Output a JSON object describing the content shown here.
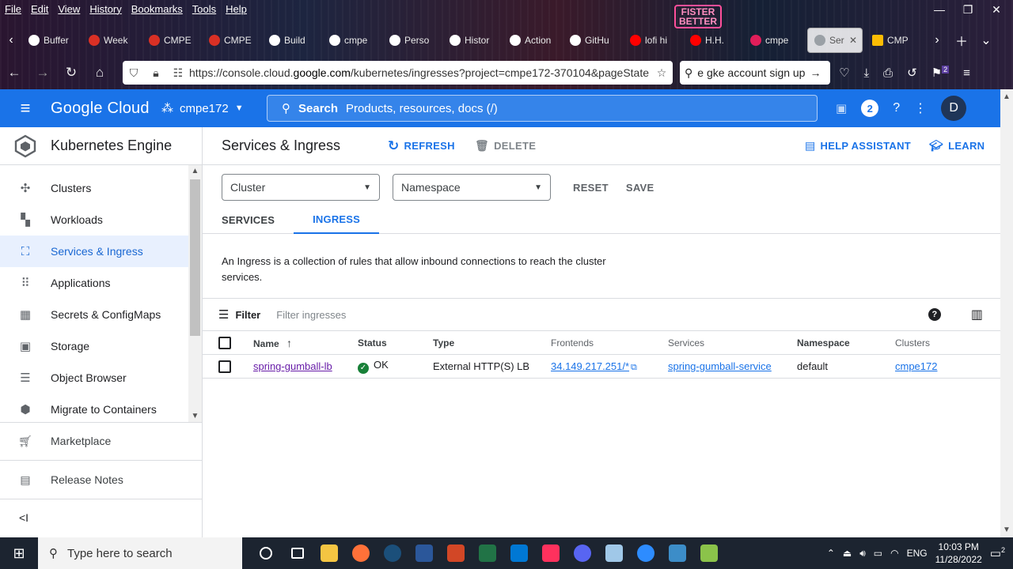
{
  "browser": {
    "menu": [
      "File",
      "Edit",
      "View",
      "History",
      "Bookmarks",
      "Tools",
      "Help"
    ],
    "neon_sign": [
      "FISTER",
      "BETTER"
    ],
    "tabs": [
      {
        "label": "Buffer",
        "color": "#ffffff"
      },
      {
        "label": "Week",
        "color": "#d93025"
      },
      {
        "label": "CMPE",
        "color": "#d93025"
      },
      {
        "label": "CMPE",
        "color": "#d93025"
      },
      {
        "label": "Build",
        "color": "#ffffff"
      },
      {
        "label": "cmpe",
        "color": "#ffffff"
      },
      {
        "label": "Perso",
        "color": "#ffffff"
      },
      {
        "label": "Histor",
        "color": "#ffffff"
      },
      {
        "label": "Action",
        "color": "#ffffff"
      },
      {
        "label": "GitHu",
        "color": "#ffffff"
      },
      {
        "label": "lofi hi",
        "color": "#ff0000"
      },
      {
        "label": "H.H.",
        "color": "#ff0000"
      },
      {
        "label": "cmpe",
        "color": "#e01e5a"
      }
    ],
    "active_tab": "Ser",
    "after_tab": "CMP",
    "url_prefix": "https://console.cloud.",
    "url_domain": "google.com",
    "url_rest": "/kubernetes/ingresses?project=cmpe172-370104&pageState",
    "search_value": "e gke account sign up",
    "notif_count": "2"
  },
  "header": {
    "brand": "Google Cloud",
    "project": "cmpe172",
    "search_label": "Search",
    "search_placeholder": "Products, resources, docs (/)",
    "notification_count": "2",
    "avatar_letter": "D"
  },
  "sidebar": {
    "product_title": "Kubernetes Engine",
    "items": [
      {
        "label": "Clusters",
        "icon": "✣"
      },
      {
        "label": "Workloads",
        "icon": "▚"
      },
      {
        "label": "Services & Ingress",
        "icon": "⛶"
      },
      {
        "label": "Applications",
        "icon": "⠿"
      },
      {
        "label": "Secrets & ConfigMaps",
        "icon": "▦"
      },
      {
        "label": "Storage",
        "icon": "▣"
      },
      {
        "label": "Object Browser",
        "icon": "☰"
      },
      {
        "label": "Migrate to Containers",
        "icon": "⬢"
      }
    ],
    "marketplace": "Marketplace",
    "release_notes": "Release Notes",
    "collapse": "<I"
  },
  "page": {
    "title": "Services & Ingress",
    "refresh": "REFRESH",
    "delete": "DELETE",
    "help_assistant": "HELP ASSISTANT",
    "learn": "LEARN",
    "cluster_placeholder": "Cluster",
    "namespace_placeholder": "Namespace",
    "reset": "RESET",
    "save": "SAVE",
    "tabs": [
      "SERVICES",
      "INGRESS"
    ],
    "description": "An Ingress is a collection of rules that allow inbound connections to reach the cluster services.",
    "filter_label": "Filter",
    "filter_placeholder": "Filter ingresses"
  },
  "table": {
    "columns": [
      "Name",
      "Status",
      "Type",
      "Frontends",
      "Services",
      "Namespace",
      "Clusters"
    ],
    "rows": [
      {
        "name": "spring-gumball-lb",
        "status": "OK",
        "type": "External HTTP(S) LB",
        "frontends": "34.149.217.251/*",
        "services": "spring-gumball-service",
        "namespace": "default",
        "clusters": "cmpe172"
      }
    ]
  },
  "taskbar": {
    "search_placeholder": "Type here to search",
    "language": "ENG",
    "time": "10:03 PM",
    "date": "11/28/2022",
    "notif_count": "2",
    "apps": [
      {
        "name": "cortana",
        "color": "#1c2430"
      },
      {
        "name": "task-view",
        "color": "#1c2430"
      },
      {
        "name": "file-explorer",
        "color": "#f4c542"
      },
      {
        "name": "firefox",
        "color": "#ff7139"
      },
      {
        "name": "steam",
        "color": "#1b4f7a"
      },
      {
        "name": "word",
        "color": "#2b579a"
      },
      {
        "name": "powerpoint",
        "color": "#d24726"
      },
      {
        "name": "excel",
        "color": "#217346"
      },
      {
        "name": "vscode",
        "color": "#0078d4"
      },
      {
        "name": "intellij",
        "color": "#fe315d"
      },
      {
        "name": "discord",
        "color": "#5865f2"
      },
      {
        "name": "paint",
        "color": "#a0c8e8"
      },
      {
        "name": "zoom",
        "color": "#2d8cff"
      },
      {
        "name": "photos",
        "color": "#3c8dc8"
      },
      {
        "name": "notepad",
        "color": "#8bc34a"
      }
    ]
  }
}
